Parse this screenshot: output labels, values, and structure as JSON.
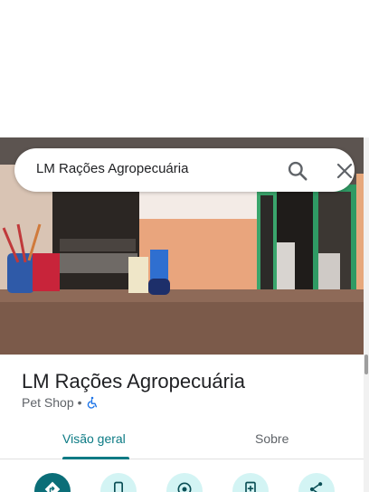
{
  "search": {
    "query": "LM Rações Agropecuária"
  },
  "place": {
    "name": "LM Rações Agropecuária",
    "category": "Pet Shop",
    "separator": "•"
  },
  "tabs": [
    {
      "label": "Visão geral",
      "selected": true
    },
    {
      "label": "Sobre",
      "selected": false
    }
  ],
  "actions": [
    {
      "icon": "directions-icon"
    },
    {
      "icon": "phone-icon"
    },
    {
      "icon": "location-icon"
    },
    {
      "icon": "save-document-icon"
    },
    {
      "icon": "share-icon"
    }
  ],
  "colors": {
    "accent": "#0b7a84",
    "action_bg": "#d3f4f4",
    "primary_action": "#0b6e78"
  }
}
